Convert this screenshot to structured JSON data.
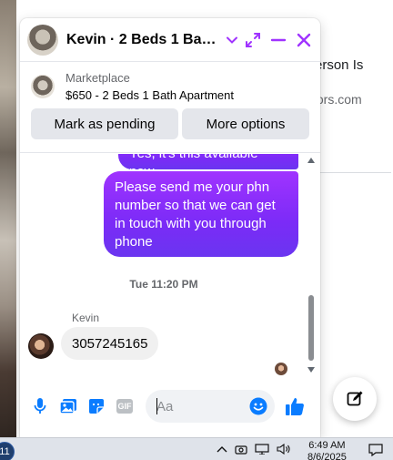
{
  "background": {
    "snippet_1": "erson Is",
    "snippet_2": "tors.com"
  },
  "chat": {
    "header": {
      "title": "Kevin · 2 Beds 1 Bath A...",
      "icons": [
        "chevron-down-icon",
        "expand-icon",
        "minimize-icon",
        "close-icon"
      ]
    },
    "listing": {
      "source": "Marketplace",
      "title": "$650 - 2 Beds 1 Bath Apartment",
      "buttons": {
        "pending": "Mark as pending",
        "more": "More options"
      }
    },
    "messages": {
      "outgoing_1": "Yes, it's this available now.",
      "outgoing_2": "Please send me your phn number so that we can get in touch with you through phone",
      "timestamp": "Tue 11:20 PM",
      "sender_name": "Kevin",
      "incoming_1": "3057245165"
    },
    "composer": {
      "placeholder": "Aa",
      "gif_label": "GIF",
      "icons": [
        "microphone-icon",
        "photo-icon",
        "sticker-icon",
        "gif-icon",
        "emoji-icon",
        "thumbs-up-icon"
      ]
    }
  },
  "taskbar": {
    "badge": "11",
    "time": "6:49 AM",
    "date": "8/6/2025"
  },
  "colors": {
    "accent": "#a033ff",
    "accent_dark": "#6a35f0",
    "icon_blue": "#0a7cff"
  }
}
